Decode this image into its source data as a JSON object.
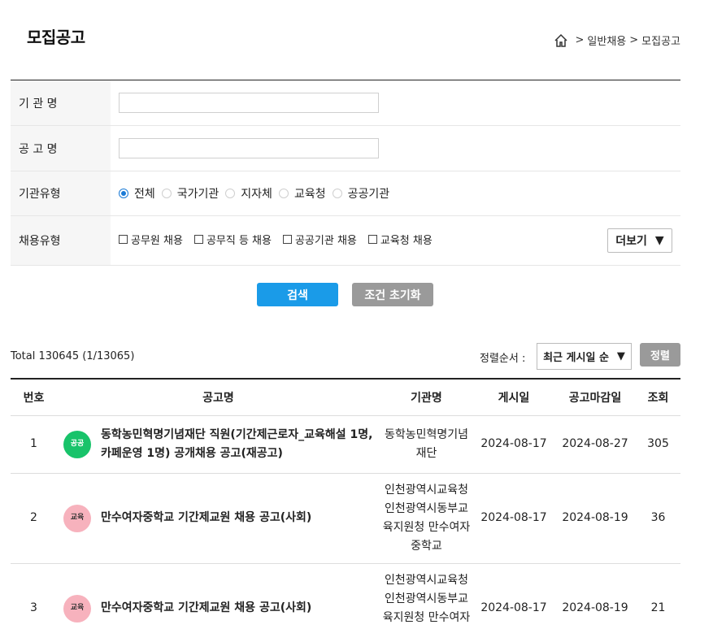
{
  "header": {
    "title": "모집공고"
  },
  "breadcrumb": {
    "home_icon": "home-icon",
    "sep": ">",
    "items": [
      "일반채용",
      "모집공고"
    ]
  },
  "form": {
    "org_label": "기 관 명",
    "org_value": "",
    "title_label": "공 고 명",
    "title_value": "",
    "org_type_label": "기관유형",
    "org_types": [
      "전체",
      "국가기관",
      "지자체",
      "교육청",
      "공공기관"
    ],
    "org_type_selected": "전체",
    "hire_type_label": "채용유형",
    "hire_types": [
      "공무원 채용",
      "공무직 등 채용",
      "공공기관 채용",
      "교육청 채용"
    ],
    "more_label": "더보기",
    "more_arrow": "▼"
  },
  "buttons": {
    "search": "검색",
    "reset": "조건 초기화"
  },
  "list_controls": {
    "total": "Total 130645 (1/13065)",
    "sort_label": "정렬순서 :",
    "sort_value": "최근 게시일 순",
    "sort_arrow": "▼",
    "sort_button": "정렬"
  },
  "table": {
    "headers": [
      "번호",
      "공고명",
      "기관명",
      "게시일",
      "공고마감일",
      "조회"
    ],
    "rows": [
      {
        "no": "1",
        "badge": "공공",
        "badge_color": "#18c36a",
        "title": "동학농민혁명기념재단 직원(기간제근로자_교육해설 1명, 카페운영 1명) 공개채용 공고(재공고)",
        "org": "동학농민혁명기념재단",
        "posted": "2024-08-17",
        "deadline": "2024-08-27",
        "views": "305"
      },
      {
        "no": "2",
        "badge": "교육",
        "badge_color": "#f7b2bd",
        "title": "만수여자중학교 기간제교원 채용 공고(사회)",
        "org": "인천광역시교육청 인천광역시동부교육지원청 만수여자중학교",
        "posted": "2024-08-17",
        "deadline": "2024-08-19",
        "views": "36"
      },
      {
        "no": "3",
        "badge": "교육",
        "badge_color": "#f7b2bd",
        "title": "만수여자중학교 기간제교원 채용 공고(사회)",
        "org": "인천광역시교육청 인천광역시동부교육지원청 만수여자중학교",
        "posted": "2024-08-17",
        "deadline": "2024-08-19",
        "views": "21"
      }
    ]
  }
}
